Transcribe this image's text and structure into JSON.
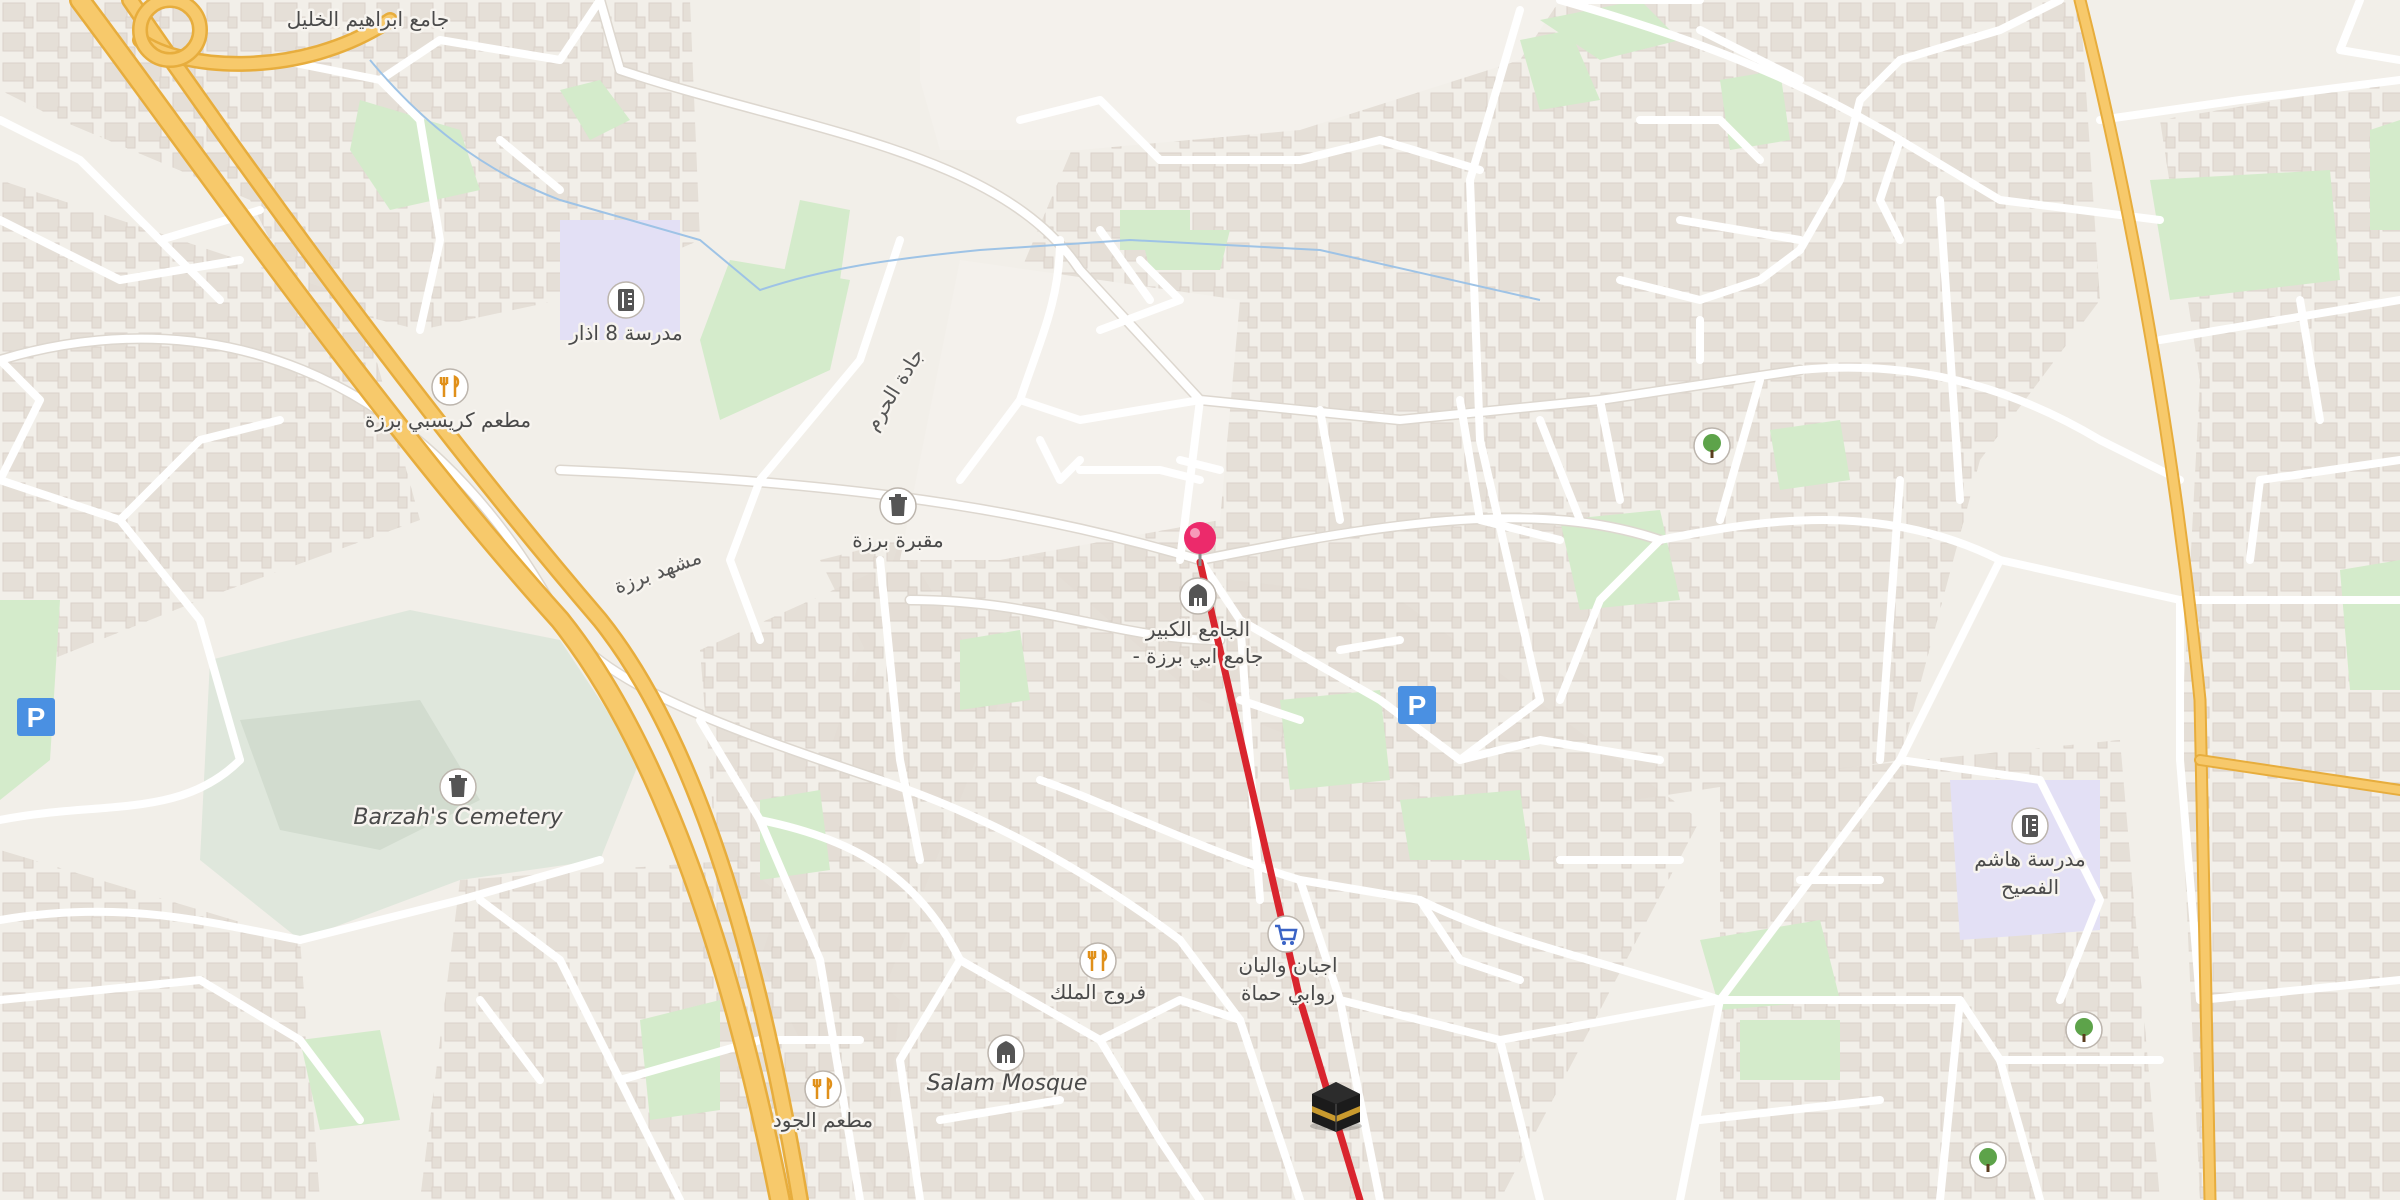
{
  "map": {
    "colors": {
      "background": "#f2efe9",
      "building": "#e4ddd5",
      "park": "#d4ebcb",
      "school": "#e3e0f5",
      "cemetery": "#dfe7dc",
      "road": "#ffffff",
      "highway": "#f7c96b",
      "highway_edge": "#e7ad3d",
      "route": "#d9252e",
      "pin": "#ec2a6b",
      "parking": "#4a90e2"
    },
    "labels": {
      "top_mosque": "جامع ابراهيم الخليل",
      "school_8_adar": "مدرسة 8 اذار",
      "restaurant_crispy": "مطعم كريسبي برزة",
      "street_haram": "جادة الحرم",
      "cemetery_barzeh_ar": "مقبرة برزة",
      "street_mashhad": "مشهد برزة",
      "great_mosque_line1": "الجامع الكبير",
      "great_mosque_line2": "- جامع ابي برزة",
      "barzah_cemetery": "Barzah's Cemetery",
      "cheese_shop_line1": "اجبان والبان",
      "cheese_shop_line2": "روابي حماة",
      "frouj_almalek": "فروج الملك",
      "salam_mosque": "Salam Mosque",
      "restaurant_jood": "مطعم الجود",
      "school_hashem_line1": "مدرسة هاشم",
      "school_hashem_line2": "الفصيح",
      "parking_symbol": "P"
    },
    "icons": {
      "school": "school-icon",
      "restaurant": "restaurant-icon",
      "cemetery": "cemetery-icon",
      "mosque": "mosque-icon",
      "shop": "shopping-cart-icon",
      "parking": "parking-icon",
      "tree": "tree-icon",
      "pin": "location-pin-icon",
      "destination": "kaaba-icon"
    }
  }
}
